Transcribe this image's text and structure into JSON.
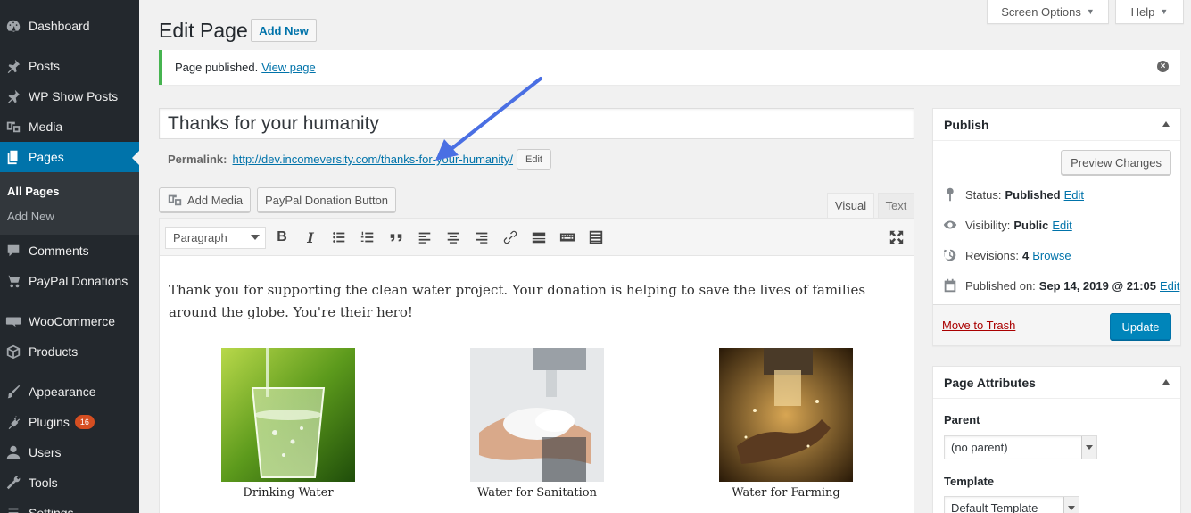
{
  "sidebar": {
    "items": [
      {
        "label": "Dashboard",
        "icon": "dashboard-icon"
      },
      {
        "label": "Posts",
        "icon": "pushpin-icon"
      },
      {
        "label": "WP Show Posts",
        "icon": "pushpin-icon"
      },
      {
        "label": "Media",
        "icon": "media-icon"
      },
      {
        "label": "Pages",
        "icon": "pages-icon"
      },
      {
        "label": "Comments",
        "icon": "comment-icon"
      },
      {
        "label": "PayPal Donations",
        "icon": "cart-icon"
      },
      {
        "label": "WooCommerce",
        "icon": "woocommerce-icon"
      },
      {
        "label": "Products",
        "icon": "box-icon"
      },
      {
        "label": "Appearance",
        "icon": "paintbrush-icon"
      },
      {
        "label": "Plugins",
        "icon": "plug-icon"
      },
      {
        "label": "Users",
        "icon": "user-icon"
      },
      {
        "label": "Tools",
        "icon": "wrench-icon"
      },
      {
        "label": "Settings",
        "icon": "settings-icon"
      }
    ],
    "submenu": {
      "all_pages": "All Pages",
      "add_new": "Add New"
    },
    "plugins_badge": "16"
  },
  "top_tabs": {
    "screen_options": "Screen Options",
    "help": "Help"
  },
  "header": {
    "title": "Edit Page",
    "add_new": "Add New"
  },
  "notice": {
    "text": "Page published.",
    "link": "View page"
  },
  "post": {
    "title": "Thanks for your humanity",
    "permalink_label": "Permalink:",
    "permalink_url": "http://dev.incomeversity.com/thanks-for-your-humanity/",
    "permalink_edit": "Edit"
  },
  "editor": {
    "add_media": "Add Media",
    "paypal_button": "PayPal Donation Button",
    "tab_visual": "Visual",
    "tab_text": "Text",
    "format": "Paragraph",
    "body": "Thank you for supporting the clean water project. Your donation is helping to save the lives of families around the globe. You're their hero!",
    "gallery": [
      {
        "caption": "Drinking Water"
      },
      {
        "caption": "Water for Sanitation"
      },
      {
        "caption": "Water for Farming"
      }
    ]
  },
  "publish": {
    "title": "Publish",
    "preview": "Preview Changes",
    "status_label": "Status:",
    "status_value": "Published",
    "status_edit": "Edit",
    "visibility_label": "Visibility:",
    "visibility_value": "Public",
    "visibility_edit": "Edit",
    "revisions_label": "Revisions:",
    "revisions_value": "4",
    "revisions_link": "Browse",
    "published_label": "Published on:",
    "published_value": "Sep 14, 2019 @ 21:05",
    "published_edit": "Edit",
    "trash": "Move to Trash",
    "update": "Update"
  },
  "page_attributes": {
    "title": "Page Attributes",
    "parent_label": "Parent",
    "parent_value": "(no parent)",
    "template_label": "Template",
    "template_value": "Default Template"
  },
  "colors": {
    "accent": "#0073aa",
    "sidebar": "#23282d",
    "notice": "#46b450",
    "arrow": "#4a6fe3"
  }
}
